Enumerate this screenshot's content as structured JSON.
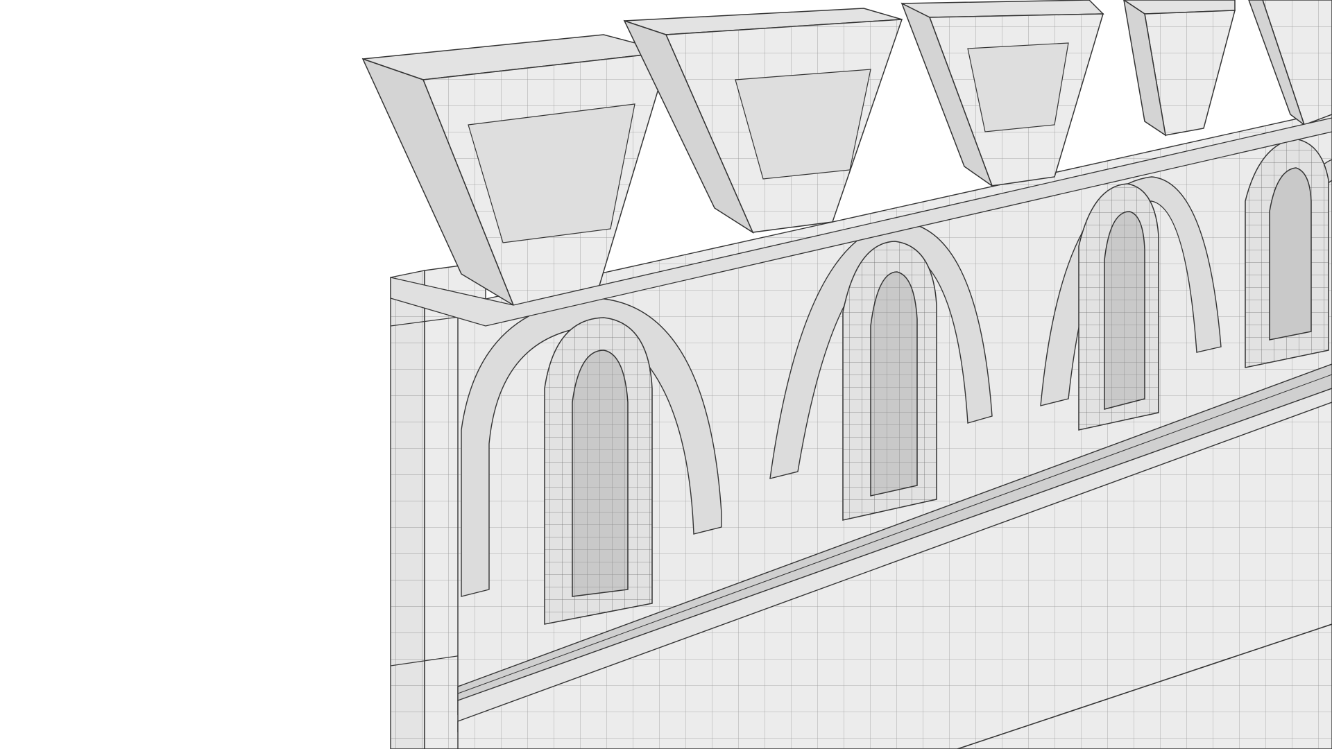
{
  "scene": {
    "background_color": "#ffffff",
    "wall_color": "#e9e9e9",
    "wall_shade_color": "#d7d7d7",
    "wall_dark_color": "#c3c3c3",
    "wire_color": "#3a3a3a",
    "subject": "wireframe-render-castle-wall",
    "crenel_count": 5,
    "arched_window_count": 4
  }
}
